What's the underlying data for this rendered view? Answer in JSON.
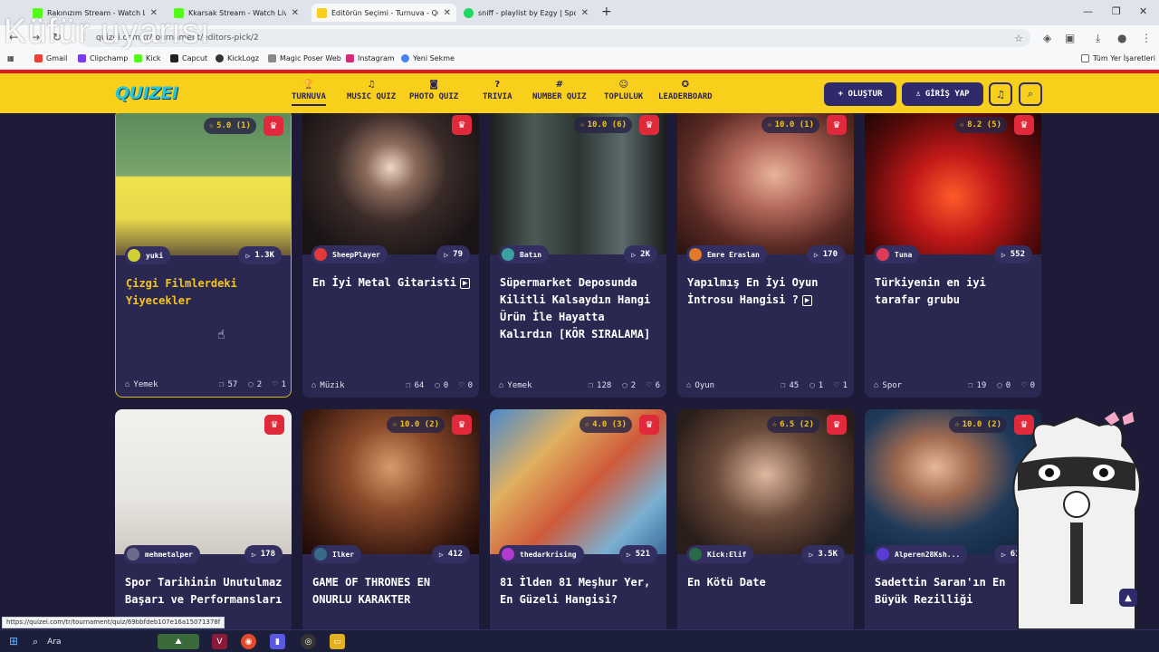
{
  "browser": {
    "tabs": [
      {
        "title": "Rakınızım Stream - Watch Live",
        "color": "#53fc18",
        "active": false
      },
      {
        "title": "Kkarsak Stream - Watch Live on",
        "color": "#53fc18",
        "active": false
      },
      {
        "title": "Editörün Seçimi - Turnuva - Qu",
        "color": "#f8cf1b",
        "active": true
      },
      {
        "title": "sniff - playlist by Ezgy | Spotify",
        "color": "#1ed760",
        "active": false
      }
    ],
    "url": "quizei.com/tr/tournament/editors-pick/2",
    "watermark": "Küfür uyarısı",
    "bookmarks": [
      "Gmail",
      "Clipchamp",
      "Kick",
      "Capcut",
      "KickLogz",
      "Magic Poser Web",
      "Instagram",
      "Yeni Sekme"
    ],
    "all_bookmarks": "Tüm Yer İşaretleri",
    "status_url": "https://quizei.com/tr/tournament/quiz/69bbfdeb107e16a15071378f"
  },
  "site": {
    "logo": "QUIZEI",
    "nav": [
      {
        "label": "TURNUVA",
        "icon": "trophy-icon",
        "glyph": "🏆",
        "active": true
      },
      {
        "label": "MUSIC QUIZ",
        "icon": "music-icon",
        "glyph": "♫",
        "active": false
      },
      {
        "label": "PHOTO QUIZ",
        "icon": "camera-icon",
        "glyph": "◙",
        "active": false
      },
      {
        "label": "TRIVIA",
        "icon": "question-icon",
        "glyph": "?",
        "active": false
      },
      {
        "label": "NUMBER QUIZ",
        "icon": "hash-icon",
        "glyph": "#",
        "active": false
      },
      {
        "label": "TOPLULUK",
        "icon": "people-icon",
        "glyph": "☺",
        "active": false
      },
      {
        "label": "LEADERBOARD",
        "icon": "medal-icon",
        "glyph": "✪",
        "active": false
      }
    ],
    "create_label": "+ OLUŞTUR",
    "login_label": "GİRİŞ YAP",
    "accent": "#f8cf1b",
    "brand_dark": "#2e2a6b"
  },
  "cards": [
    {
      "title": "Çizgi Filmlerdeki Yiyecekler",
      "rating": "5.0 (1)",
      "author": "yuki",
      "author_color": "#d0d035",
      "plays": "1.3K",
      "category": "Yemek",
      "items": "57",
      "comments": "2",
      "likes": "1",
      "video": false,
      "highlight": true,
      "img": "img-sponge"
    },
    {
      "title": "En İyi Metal Gitaristi",
      "rating": "",
      "author": "SheepPlayer",
      "author_color": "#e03a3a",
      "plays": "79",
      "category": "Müzik",
      "items": "64",
      "comments": "0",
      "likes": "0",
      "video": true,
      "highlight": false,
      "img": "img-metal"
    },
    {
      "title": "Süpermarket Deposunda Kilitli Kalsaydın Hangi Ürün İle Hayatta Kalırdın [KÖR SIRALAMA]",
      "rating": "10.0 (6)",
      "author": "Batın",
      "author_color": "#3aa0a0",
      "plays": "2K",
      "category": "Yemek",
      "items": "128",
      "comments": "2",
      "likes": "6",
      "video": false,
      "highlight": false,
      "img": "img-market"
    },
    {
      "title": "Yapılmış En İyi Oyun İntrosu Hangisi ?",
      "rating": "10.0 (1)",
      "author": "Emre Eraslan",
      "author_color": "#e07a2a",
      "plays": "170",
      "category": "Oyun",
      "items": "45",
      "comments": "1",
      "likes": "1",
      "video": true,
      "highlight": false,
      "img": "img-game"
    },
    {
      "title": "Türkiyenin en iyi tarafar grubu",
      "rating": "8.2 (5)",
      "author": "Tuna",
      "author_color": "#e03a5a",
      "plays": "552",
      "category": "Spor",
      "items": "19",
      "comments": "0",
      "likes": "0",
      "video": false,
      "highlight": false,
      "img": "img-fans"
    },
    {
      "title": "Spor Tarihinin Unutulmaz Başarı ve Performansları",
      "rating": "",
      "author": "mehmetalper",
      "author_color": "#6a6a8a",
      "plays": "178",
      "category": "",
      "items": "",
      "comments": "",
      "likes": "",
      "video": false,
      "highlight": false,
      "img": "img-sport"
    },
    {
      "title": "GAME OF THRONES EN ONURLU KARAKTER",
      "rating": "10.0 (2)",
      "author": "Ilker",
      "author_color": "#3a6a8a",
      "plays": "412",
      "category": "",
      "items": "",
      "comments": "",
      "likes": "",
      "video": false,
      "highlight": false,
      "img": "img-got"
    },
    {
      "title": "81 İlden 81 Meşhur Yer, En Güzeli Hangisi?",
      "rating": "4.0 (3)",
      "author": "thedarkrising",
      "author_color": "#b03ad0",
      "plays": "521",
      "category": "",
      "items": "",
      "comments": "",
      "likes": "",
      "video": false,
      "highlight": false,
      "img": "img-collage"
    },
    {
      "title": "En Kötü Date",
      "rating": "6.5 (2)",
      "author": "Kick:Elif",
      "author_color": "#2a6a4a",
      "plays": "3.5K",
      "category": "",
      "items": "",
      "comments": "",
      "likes": "",
      "video": false,
      "highlight": false,
      "img": "img-date"
    },
    {
      "title": "Sadettin Saran'ın En Büyük Rezilliği",
      "rating": "10.0 (2)",
      "author": "Alperen28Ksh...",
      "author_color": "#5a3ad0",
      "plays": "613",
      "category": "",
      "items": "",
      "comments": "",
      "likes": "",
      "video": false,
      "highlight": false,
      "img": "img-saran"
    }
  ],
  "taskbar": {
    "search": "Ara"
  }
}
